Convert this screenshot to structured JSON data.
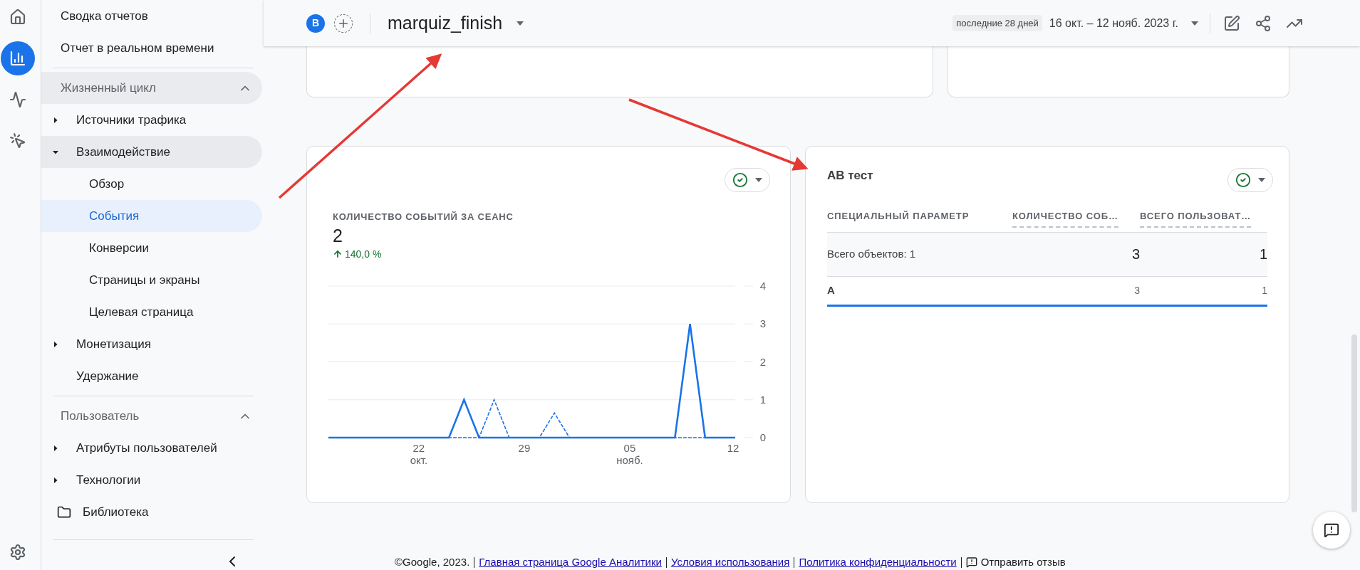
{
  "nav_rail": {
    "items": [
      {
        "kind": "home",
        "selected": false
      },
      {
        "kind": "reports",
        "selected": true
      },
      {
        "kind": "explore",
        "selected": false
      },
      {
        "kind": "advertising",
        "selected": false
      }
    ],
    "bottom": {
      "kind": "settings",
      "selected": false
    }
  },
  "sidebar": {
    "top_links": [
      {
        "label": "Сводка отчетов",
        "selected": false
      },
      {
        "label": "Отчет в реальном времени",
        "selected": false
      }
    ],
    "sections": [
      {
        "title": "Жизненный цикл",
        "expanded": true,
        "highlighted": true,
        "items": [
          {
            "kind": "group",
            "label": "Источники трафика",
            "expanded": false,
            "active": false
          },
          {
            "kind": "group",
            "label": "Взаимодействие",
            "expanded": true,
            "active": true,
            "children": [
              {
                "label": "Обзор",
                "selected": false
              },
              {
                "label": "События",
                "selected": true
              },
              {
                "label": "Конверсии",
                "selected": false
              },
              {
                "label": "Страницы и экраны",
                "selected": false
              },
              {
                "label": "Целевая страница",
                "selected": false
              }
            ]
          },
          {
            "kind": "group",
            "label": "Монетизация",
            "expanded": false,
            "active": false
          },
          {
            "kind": "link",
            "label": "Удержание",
            "active": false
          }
        ]
      },
      {
        "title": "Пользователь",
        "expanded": true,
        "highlighted": false,
        "items": [
          {
            "kind": "group",
            "label": "Атрибуты пользователей",
            "expanded": false,
            "active": false
          },
          {
            "kind": "group",
            "label": "Технологии",
            "expanded": false,
            "active": false
          }
        ]
      }
    ],
    "library": "Библиотека"
  },
  "header": {
    "avatar": "B",
    "title": "marquiz_finish",
    "period_chip": "последние 28 дней",
    "date_range": "16 окт. – 12 нояб. 2023 г."
  },
  "chart_card": {
    "metric": "КОЛИЧЕСТВО СОБЫТИЙ ЗА СЕАНС",
    "value": "2",
    "change": "140,0 %",
    "change_up": true,
    "chart_data": {
      "type": "line",
      "categories": [
        null,
        null,
        null,
        null,
        null,
        null,
        "22",
        null,
        null,
        null,
        null,
        null,
        null,
        "29",
        null,
        null,
        null,
        null,
        null,
        null,
        "05",
        null,
        null,
        null,
        null,
        null,
        null,
        "12"
      ],
      "ylim": [
        0,
        4
      ],
      "yticks": [
        0,
        1,
        2,
        3,
        4
      ],
      "grid": true,
      "annotations": [
        "окт.",
        "нояб."
      ],
      "series": [
        {
          "color": "#1a73e8",
          "line_style": "solid",
          "values": [
            0,
            0,
            0,
            0,
            0,
            0,
            0,
            0,
            0,
            1,
            0,
            0,
            0,
            0,
            0,
            0,
            0,
            0,
            0,
            0,
            0,
            0,
            0,
            0,
            3,
            0,
            0,
            0
          ]
        },
        {
          "color": "#1a73e8",
          "line_style": "dashed",
          "values": [
            0,
            0,
            0,
            0,
            0,
            0,
            0,
            0,
            0,
            0,
            0,
            1,
            0,
            0,
            0,
            0.65,
            0,
            0,
            0,
            0,
            0,
            0,
            0,
            0,
            0,
            0,
            0,
            0
          ]
        }
      ]
    }
  },
  "table_card": {
    "title": "AB тест",
    "columns": [
      "СПЕЦИАЛЬНЫЙ ПАРАМЕТР",
      "КОЛИЧЕСТВО СОБ…",
      "ВСЕГО ПОЛЬЗОВАТ…"
    ],
    "rows": [
      {
        "kind": "total",
        "cells": [
          "Всего объектов: 1",
          "3",
          "1"
        ]
      },
      {
        "kind": "data",
        "cells": [
          "A",
          "3",
          "1"
        ]
      }
    ]
  },
  "footer": {
    "copyright": "©Google, 2023.",
    "links": [
      "Главная страница Google Аналитики",
      "Условия использования",
      "Политика конфиденциальности"
    ],
    "feedback": "Отправить отзыв"
  }
}
